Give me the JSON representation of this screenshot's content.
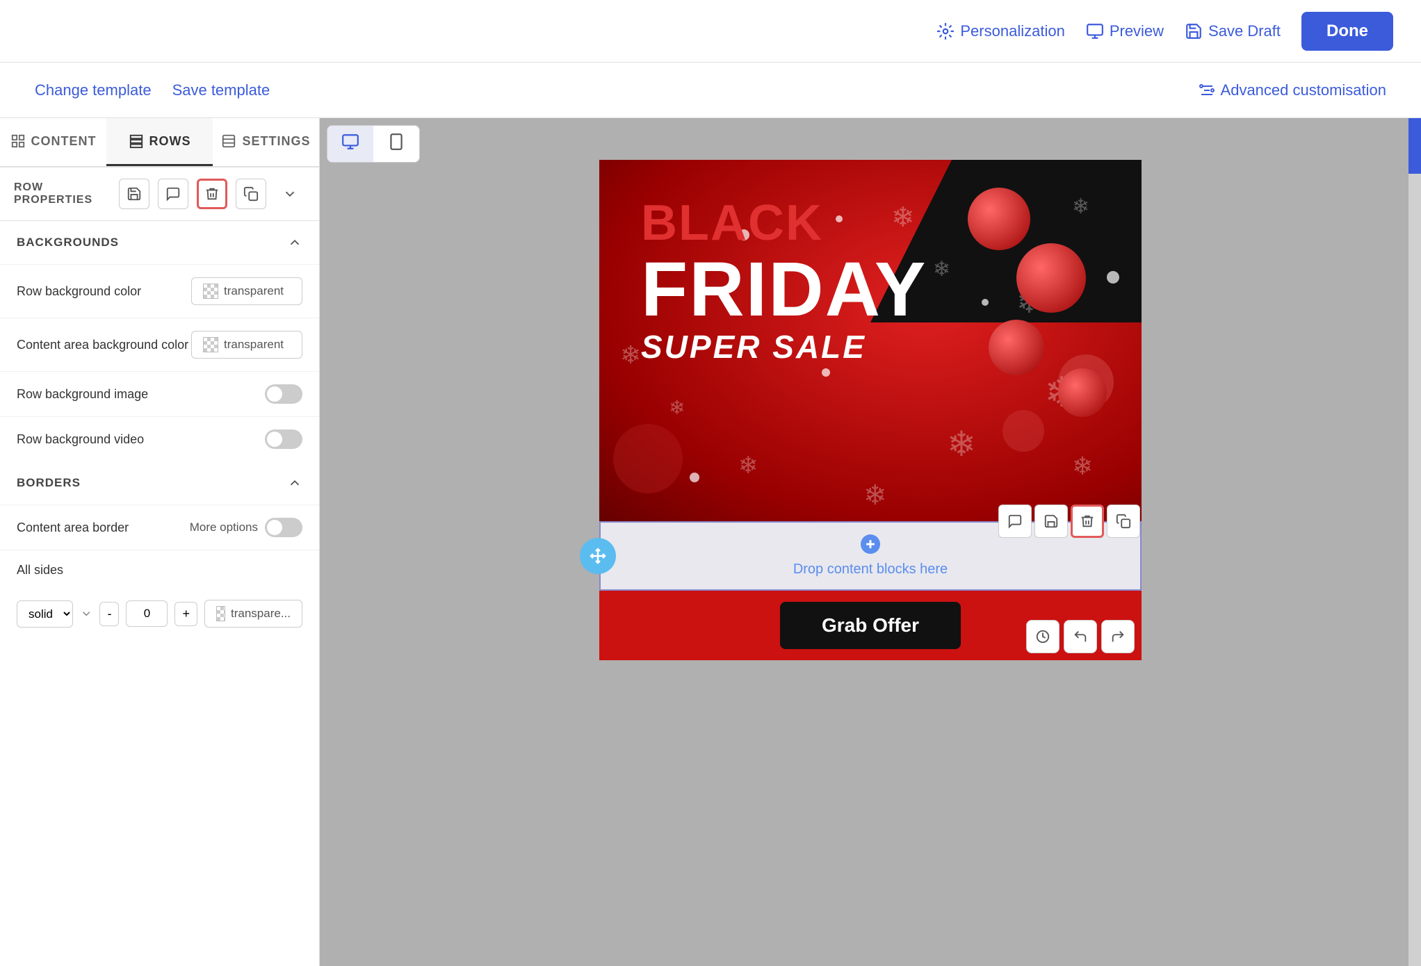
{
  "topbar": {
    "personalization_label": "Personalization",
    "preview_label": "Preview",
    "save_draft_label": "Save Draft",
    "done_label": "Done"
  },
  "templatebar": {
    "change_template_label": "Change template",
    "save_template_label": "Save template",
    "advanced_customisation_label": "Advanced customisation"
  },
  "tabs": [
    {
      "id": "content",
      "label": "CONTENT"
    },
    {
      "id": "rows",
      "label": "ROWS"
    },
    {
      "id": "settings",
      "label": "SETTINGS"
    }
  ],
  "row_properties": {
    "label": "ROW PROPERTIES"
  },
  "backgrounds": {
    "section_label": "BACKGROUNDS",
    "row_background_color_label": "Row background color",
    "row_background_color_value": "transparent",
    "content_area_background_color_label": "Content area background color",
    "content_area_background_color_value": "transparent",
    "row_background_image_label": "Row background image",
    "row_background_video_label": "Row background video"
  },
  "borders": {
    "section_label": "BORDERS",
    "content_area_border_label": "Content area border",
    "more_options_label": "More options",
    "all_sides_label": "All sides",
    "border_style_value": "solid",
    "border_width_value": "0",
    "border_color_value": "transpare..."
  },
  "dropzone": {
    "drop_text": "Drop content blocks here",
    "plus_icon": "+"
  },
  "grab_offer": {
    "button_label": "Grab Offer"
  },
  "hero": {
    "black_text": "BLACK",
    "friday_text": "FRIDAY",
    "super_sale_text": "SUPER SALE"
  },
  "colors": {
    "accent_blue": "#3b5bdb",
    "red_border": "#e05a5a",
    "bg_gray": "#b0b0b0"
  }
}
